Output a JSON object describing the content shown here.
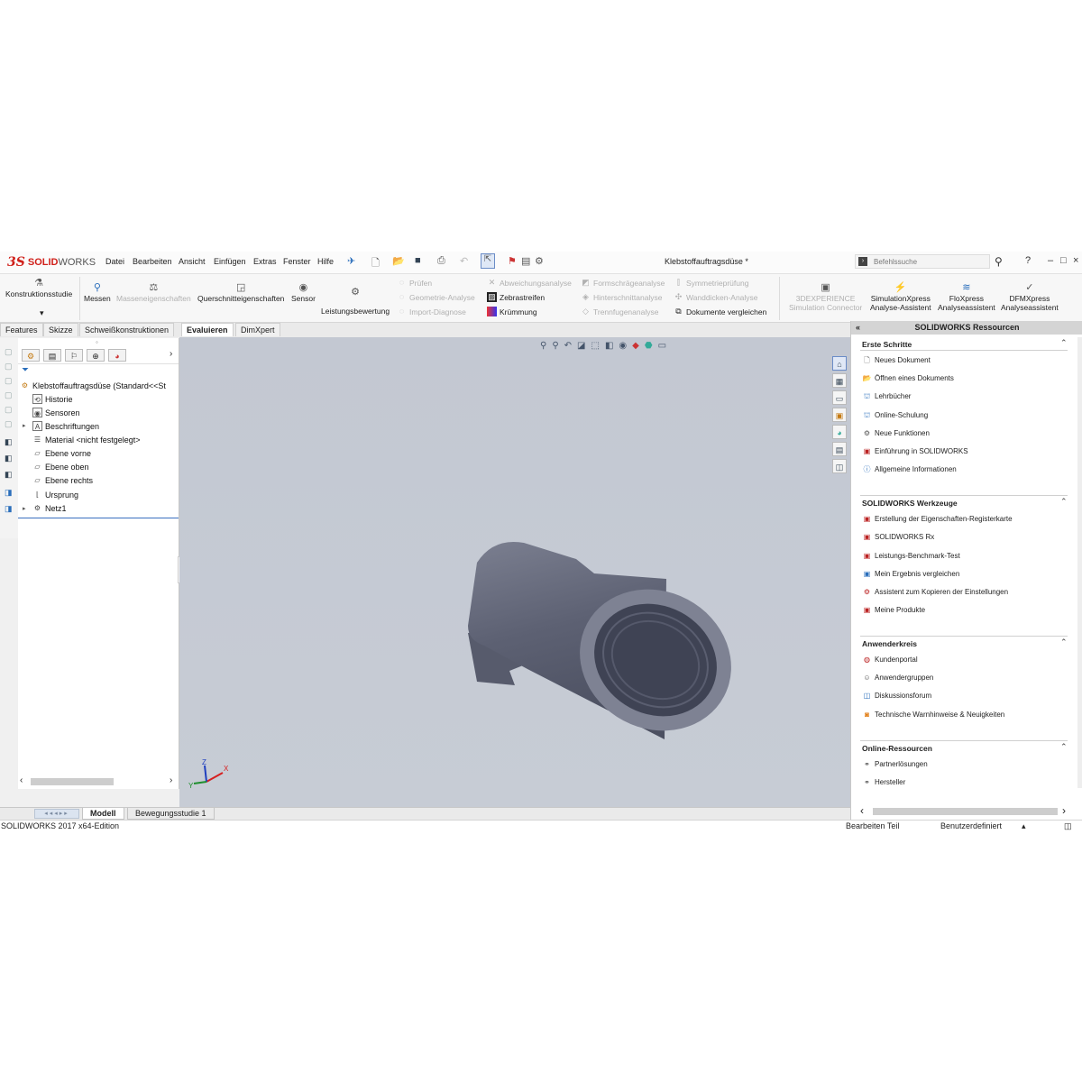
{
  "app": {
    "logo_mark": "3S",
    "logo_text_red": "SOLID",
    "logo_text_grey": "WORKS",
    "menu": [
      "Datei",
      "Bearbeiten",
      "Ansicht",
      "Einfügen",
      "Extras",
      "Fenster",
      "Hilfe"
    ],
    "document_title": "Klebstoffauftragsdüse *",
    "search_placeholder": "Befehlssuche",
    "window_controls": [
      "?",
      "–",
      "□",
      "×"
    ]
  },
  "commandmanager": {
    "konstruktionsstudie": "Konstruktionsstudie",
    "messen": "Messen",
    "masseneigenschaften": "Masseneigenschaften",
    "querschnitteigenschaften": "Querschnitteigenschaften",
    "sensor": "Sensor",
    "leistungsbewertung": "Leistungsbewertung",
    "col1": [
      "Prüfen",
      "Geometrie-Analyse",
      "Import-Diagnose"
    ],
    "col2": [
      "Abweichungsanalyse",
      "Zebrastreifen",
      "Krümmung"
    ],
    "col3": [
      "Formschrägeanalyse",
      "Hinterschnittanalyse",
      "Trennfugenanalyse"
    ],
    "col4": [
      "Symmetrieprüfung",
      "Wanddicken-Analyse",
      "Dokumente vergleichen"
    ],
    "experience_line1": "3DEXPERIENCE",
    "experience_line2": "Simulation Connector",
    "simxpress_line1": "SimulationXpress",
    "simxpress_line2": "Analyse-Assistent",
    "floxpress_line1": "FloXpress",
    "floxpress_line2": "Analyseassistent",
    "dfmxpress_line1": "DFMXpress",
    "dfmxpress_line2": "Analyseassistent"
  },
  "tabs": [
    "Features",
    "Skizze",
    "Schweißkonstruktionen",
    "Evaluieren",
    "DimXpert"
  ],
  "active_tab": "Evaluieren",
  "feature_tree": {
    "root": "Klebstoffauftragsdüse  (Standard<<St",
    "items": [
      "Historie",
      "Sensoren",
      "Beschriftungen",
      "Material <nicht festgelegt>",
      "Ebene vorne",
      "Ebene oben",
      "Ebene rechts",
      "Ursprung",
      "Netz1"
    ]
  },
  "bottom_tabs": [
    "Modell",
    "Bewegungsstudie 1"
  ],
  "status": {
    "edition": "SOLIDWORKS 2017 x64-Edition",
    "mode": "Bearbeiten Teil",
    "units": "Benutzerdefiniert"
  },
  "triad": {
    "x": "X",
    "y": "Y",
    "z": "Z"
  },
  "resources": {
    "title": "SOLIDWORKS Ressourcen",
    "sections": [
      {
        "title": "Erste Schritte",
        "items": [
          "Neues Dokument",
          "Öffnen eines Dokuments",
          "Lehrbücher",
          "Online-Schulung",
          "Neue Funktionen",
          "Einführung in SOLIDWORKS",
          "Allgemeine Informationen"
        ]
      },
      {
        "title": "SOLIDWORKS Werkzeuge",
        "items": [
          "Erstellung der Eigenschaften-Registerkarte",
          "SOLIDWORKS Rx",
          "Leistungs-Benchmark-Test",
          "Mein Ergebnis vergleichen",
          "Assistent zum Kopieren der Einstellungen",
          "Meine Produkte"
        ]
      },
      {
        "title": "Anwenderkreis",
        "items": [
          "Kundenportal",
          "Anwendergruppen",
          "Diskussionsforum",
          "Technische Warnhinweise & Neuigkeiten"
        ]
      },
      {
        "title": "Online-Ressourcen",
        "items": [
          "Partnerlösungen",
          "Hersteller"
        ]
      }
    ]
  }
}
